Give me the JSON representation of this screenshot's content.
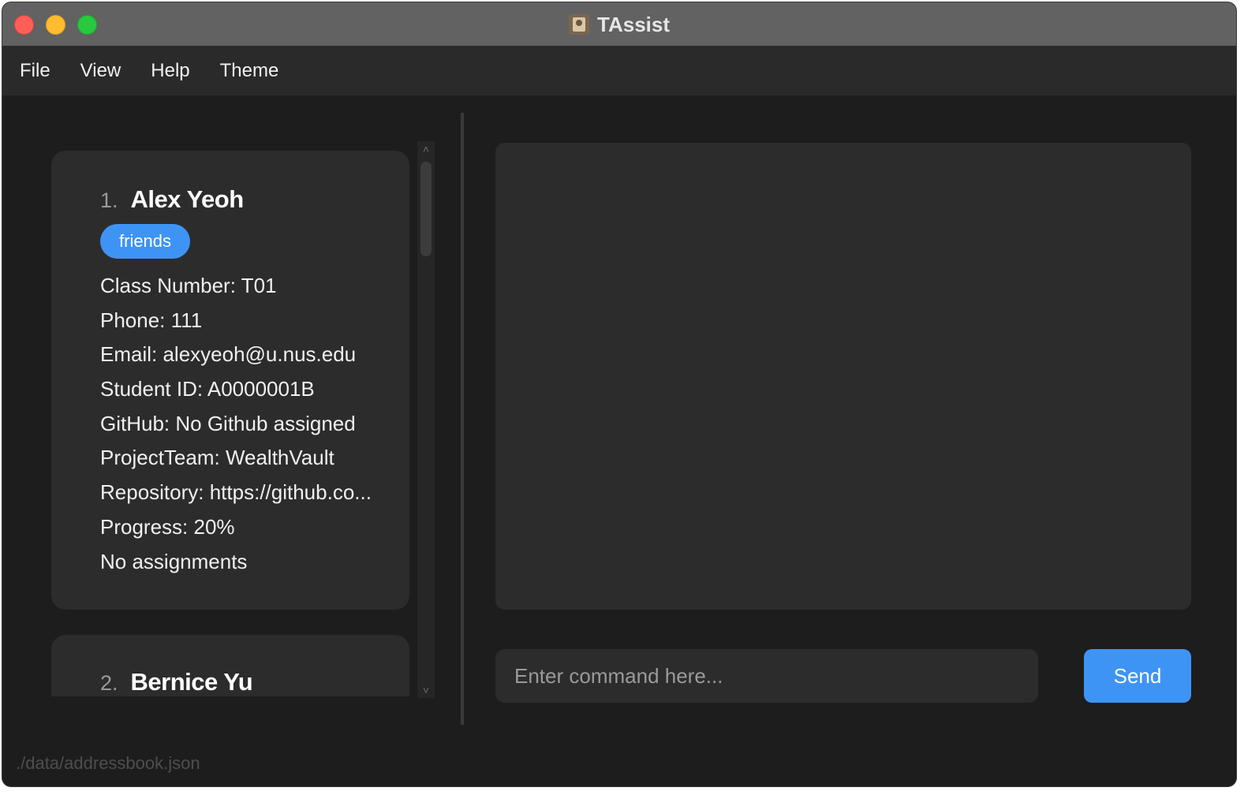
{
  "window": {
    "title": "TAssist"
  },
  "menu": [
    "File",
    "View",
    "Help",
    "Theme"
  ],
  "persons": [
    {
      "index": "1.",
      "name": "Alex Yeoh",
      "tags": [
        "friends"
      ],
      "fields": [
        "Class Number: T01",
        "Phone: 111",
        "Email: alexyeoh@u.nus.edu",
        "Student ID: A0000001B",
        "GitHub: No Github assigned",
        "ProjectTeam: WealthVault",
        "Repository: https://github.co...",
        "Progress: 20%",
        "No assignments"
      ]
    },
    {
      "index": "2.",
      "name": "Bernice Yu"
    }
  ],
  "command": {
    "placeholder": "Enter command here...",
    "value": ""
  },
  "send_label": "Send",
  "status_bar": {
    "path": "./data/addressbook.json"
  },
  "scrollbar": {
    "up_icon": "˄",
    "down_icon": "˅"
  },
  "colors": {
    "accent": "#3e94f5",
    "background": "#1d1d1d",
    "card": "#2c2c2c"
  }
}
